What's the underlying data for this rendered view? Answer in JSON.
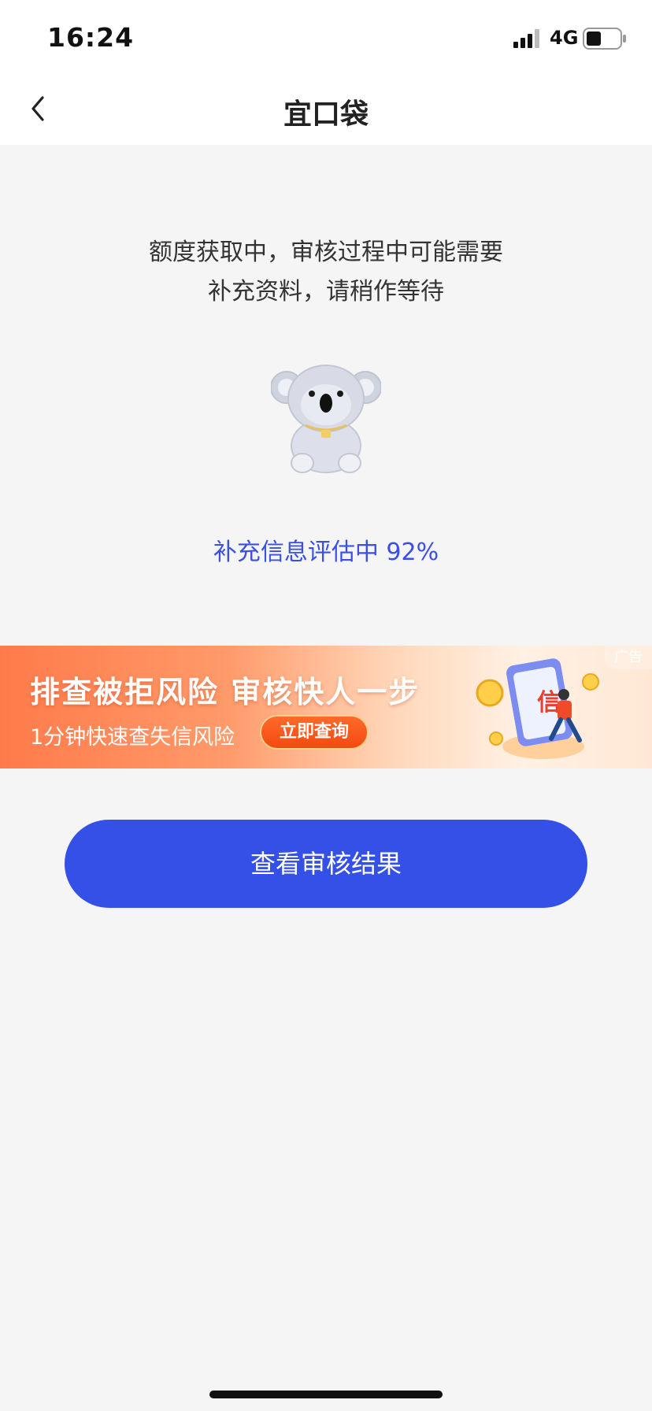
{
  "status_bar": {
    "time": "16:24",
    "network": "4G",
    "icons": [
      "signal-icon",
      "battery-icon"
    ]
  },
  "nav": {
    "title": "宜口袋",
    "back_icon": "chevron-left-icon"
  },
  "notice": {
    "line1": "额度获取中，审核过程中可能需要",
    "line2": "补充资料，请稍作等待"
  },
  "illustration": "koala-icon",
  "progress": {
    "text": "补充信息评估中 92%",
    "percent": 92
  },
  "ad": {
    "badge": "广告",
    "headline": "排查被拒风险  审核快人一步",
    "subtitle": "1分钟快速查失信风险",
    "cta": "立即查询",
    "illustration_char": "信"
  },
  "primary_button": {
    "label": "查看审核结果"
  },
  "colors": {
    "accent": "#3550e6",
    "progress_text": "#3a4fe6",
    "background": "#f5f5f5"
  }
}
